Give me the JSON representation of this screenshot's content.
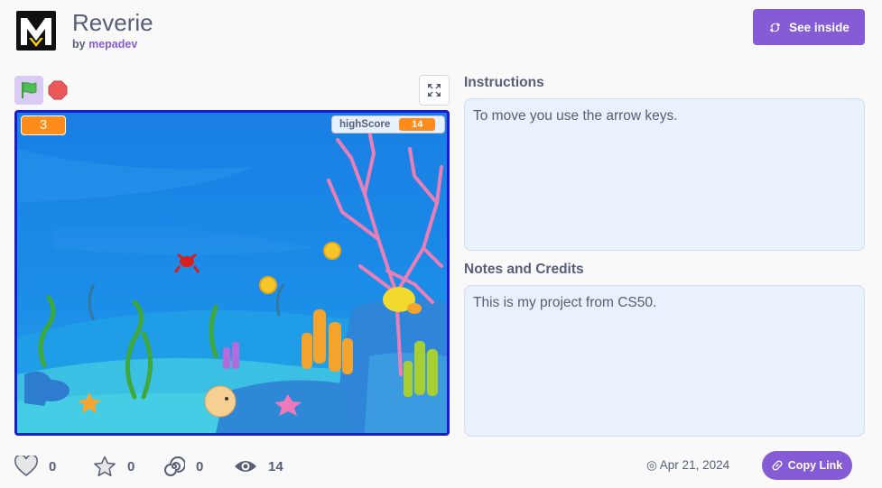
{
  "project": {
    "title": "Reverie",
    "by": "by",
    "author": "mepadev"
  },
  "header": {
    "see_inside_label": "See inside"
  },
  "controls": {
    "flag_icon": "green-flag-icon",
    "stop_icon": "stop-icon",
    "fullscreen_icon": "fullscreen-icon"
  },
  "stage": {
    "score_value": "3",
    "highscore_label": "highScore",
    "highscore_value": "14"
  },
  "instructions": {
    "label": "Instructions",
    "text": "To move you use the arrow keys."
  },
  "notes": {
    "label": "Notes and Credits",
    "text": "This is my project from CS50."
  },
  "stats": {
    "loves": "0",
    "favorites": "0",
    "remixes": "0",
    "views": "14"
  },
  "footer": {
    "date": "Apr 21, 2024",
    "copy_link_label": "Copy Link"
  },
  "colors": {
    "accent": "#855cd6",
    "stage_border": "#1a1ad1",
    "monitor_orange": "#ff8c1a",
    "text": "#575e75"
  }
}
